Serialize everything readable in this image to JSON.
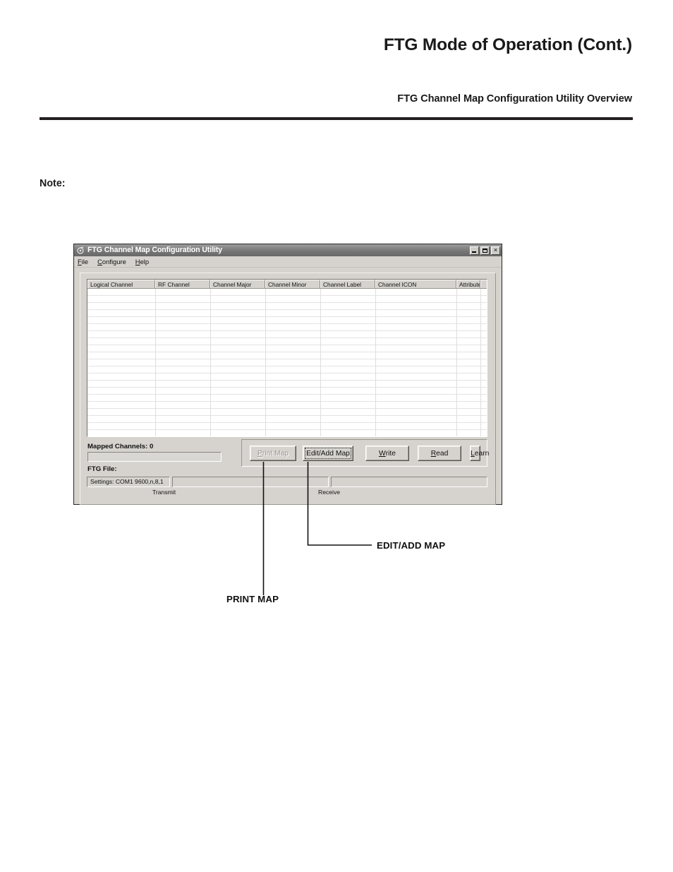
{
  "page": {
    "title": "FTG Mode of Operation (Cont.)",
    "subtitle": "FTG Channel Map Configuration Utility Overview",
    "note_label": "Note:"
  },
  "window": {
    "title": "FTG Channel Map Configuration Utility",
    "icon": "app-icon",
    "controls": {
      "minimize": "minimize-icon",
      "maximize": "maximize-icon",
      "close": "×"
    },
    "menus": [
      {
        "label": "File",
        "accel": "F"
      },
      {
        "label": "Configure",
        "accel": "C"
      },
      {
        "label": "Help",
        "accel": "H"
      }
    ],
    "grid": {
      "columns": [
        "Logical Channel",
        "RF Channel",
        "Channel Major",
        "Channel Minor",
        "Channel Label",
        "Channel ICON",
        "Attribute",
        ""
      ],
      "rows": []
    },
    "mapped_channels_label": "Mapped Channels: 0",
    "mapped_channels_value": "",
    "ftg_file_label": "FTG File:",
    "buttons": [
      {
        "name": "print-map-button",
        "label": "Print Map",
        "accel": "P",
        "state": "disabled"
      },
      {
        "name": "edit-add-map-button",
        "label": "Edit/Add Map",
        "accel": "",
        "state": "focused"
      },
      {
        "name": "write-button",
        "label": "Write",
        "accel": "W",
        "state": "normal"
      },
      {
        "name": "read-button",
        "label": "Read",
        "accel": "R",
        "state": "normal"
      },
      {
        "name": "learn-button",
        "label": "Learn",
        "accel": "L",
        "state": "normal"
      }
    ],
    "statusbar": {
      "settings": "Settings: COM1 9600,n,8,1",
      "transmit_value": "",
      "receive_value": "",
      "transmit_caption": "Transmit",
      "receive_caption": "Receive"
    }
  },
  "callouts": [
    {
      "label": "EDIT/ADD MAP"
    },
    {
      "label": "PRINT MAP"
    }
  ],
  "colors": {
    "rule": "#231f20",
    "window_face": "#d6d3ce",
    "titlebar": "#757575",
    "grid_background": "#ffffff"
  }
}
